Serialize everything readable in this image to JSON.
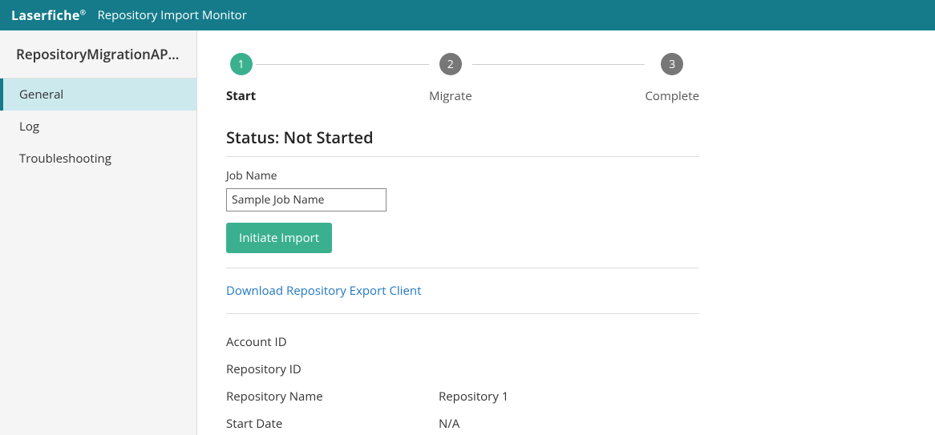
{
  "header": {
    "brand": "Laserfiche",
    "app_title": "Repository Import Monitor"
  },
  "sidebar": {
    "title": "RepositoryMigrationAPI...",
    "items": [
      {
        "label": "General",
        "active": true
      },
      {
        "label": "Log",
        "active": false
      },
      {
        "label": "Troubleshooting",
        "active": false
      }
    ]
  },
  "stepper": {
    "steps": [
      {
        "num": "1",
        "label": "Start",
        "active": true
      },
      {
        "num": "2",
        "label": "Migrate",
        "active": false
      },
      {
        "num": "3",
        "label": "Complete",
        "active": false
      }
    ]
  },
  "status": {
    "heading": "Status: Not Started",
    "job_name_label": "Job Name",
    "job_name_value": "Sample Job Name",
    "initiate_button": "Initiate Import",
    "download_link": "Download Repository Export Client"
  },
  "info": {
    "rows": [
      {
        "key": "Account ID",
        "value": ""
      },
      {
        "key": "Repository ID",
        "value": ""
      },
      {
        "key": "Repository Name",
        "value": "Repository 1"
      },
      {
        "key": "Start Date",
        "value": "N/A"
      }
    ]
  }
}
